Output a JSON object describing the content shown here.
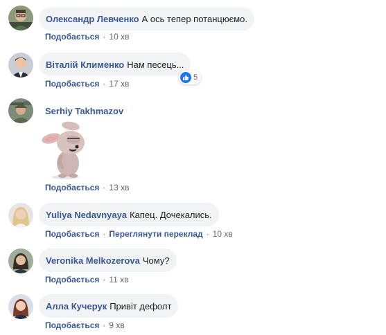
{
  "actions": {
    "like_label": "Подобається",
    "translate_label": "Переглянути переклад",
    "separator": "·"
  },
  "colors": {
    "author": "#385898",
    "bubble": "#f2f3f5",
    "meta": "#606770",
    "like_blue": "#1877f2"
  },
  "comments": [
    {
      "author": "Олександр Левченко",
      "text": "А ось тепер потанцюємо.",
      "time": "10 хв",
      "avatar_icon": "avatar-man-glasses"
    },
    {
      "author": "Віталій Клименко",
      "text": "Нам песець...",
      "time": "17 хв",
      "avatar_icon": "avatar-man-suit",
      "reaction": {
        "icon": "thumbs-up-icon",
        "count": "5"
      }
    },
    {
      "author": "Serhiy Takhmazov",
      "text": "",
      "time": "13 хв",
      "avatar_icon": "avatar-soldier",
      "sticker": "bunny-facepalm-sticker"
    },
    {
      "author": "Yuliya Nedavnyaya",
      "text": "Капец. Дочекались.",
      "time": "10 хв",
      "avatar_icon": "avatar-woman-blonde",
      "show_translate": true
    },
    {
      "author": "Veronika Melkozerova",
      "text": "Чому?",
      "time": "11 хв",
      "avatar_icon": "avatar-woman-dark"
    },
    {
      "author": "Алла Кучерук",
      "text": "Привіт дефолт",
      "time": "9 хв",
      "avatar_icon": "avatar-woman-red"
    }
  ]
}
